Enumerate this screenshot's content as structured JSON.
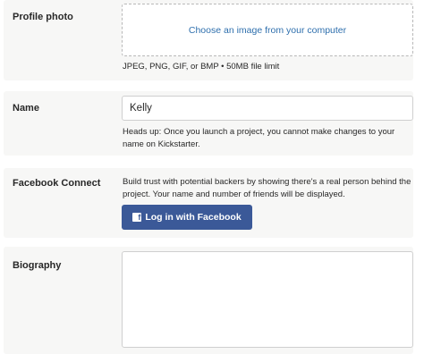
{
  "profile_photo": {
    "label": "Profile photo",
    "upload_text": "Choose an image from your computer",
    "hint": "JPEG, PNG, GIF, or BMP • 50MB file limit"
  },
  "name": {
    "label": "Name",
    "value": "Kelly",
    "hint": "Heads up: Once you launch a project, you cannot make changes to your name on Kickstarter."
  },
  "facebook": {
    "label": "Facebook Connect",
    "description": "Build trust with potential backers by showing there's a real person behind the project. Your name and number of friends will be displayed.",
    "icon_glyph": "f",
    "button_label": "Log in with Facebook",
    "brand_color": "#3b5998"
  },
  "biography": {
    "label": "Biography",
    "value": ""
  }
}
